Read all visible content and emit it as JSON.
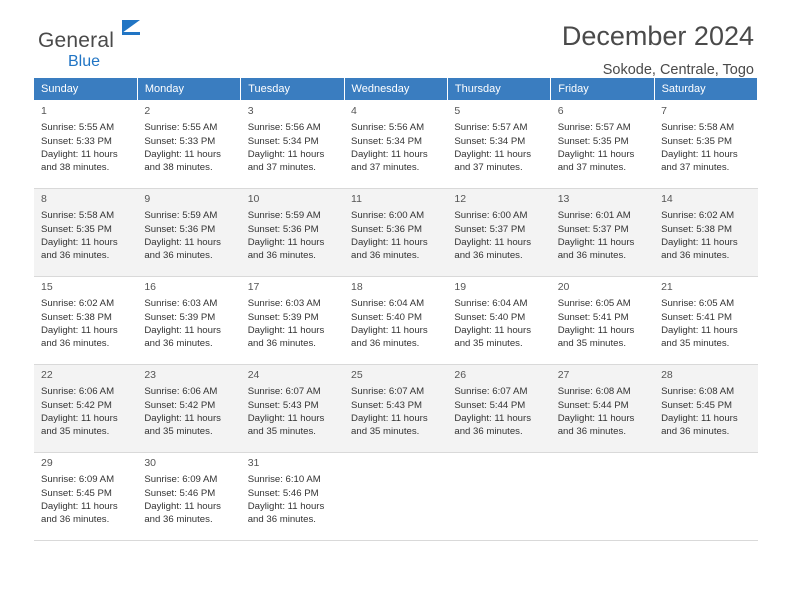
{
  "brand": {
    "line1": "General",
    "line2": "Blue",
    "accent": "#2175c4",
    "flag_icon": "flag-icon"
  },
  "header": {
    "title": "December 2024",
    "subtitle": "Sokode, Centrale, Togo"
  },
  "calendar": {
    "header_bg": "#3a7dc0",
    "weekdays": [
      "Sunday",
      "Monday",
      "Tuesday",
      "Wednesday",
      "Thursday",
      "Friday",
      "Saturday"
    ],
    "weeks": [
      [
        {
          "day": "1",
          "sunrise": "Sunrise: 5:55 AM",
          "sunset": "Sunset: 5:33 PM",
          "daylight1": "Daylight: 11 hours",
          "daylight2": "and 38 minutes."
        },
        {
          "day": "2",
          "sunrise": "Sunrise: 5:55 AM",
          "sunset": "Sunset: 5:33 PM",
          "daylight1": "Daylight: 11 hours",
          "daylight2": "and 38 minutes."
        },
        {
          "day": "3",
          "sunrise": "Sunrise: 5:56 AM",
          "sunset": "Sunset: 5:34 PM",
          "daylight1": "Daylight: 11 hours",
          "daylight2": "and 37 minutes."
        },
        {
          "day": "4",
          "sunrise": "Sunrise: 5:56 AM",
          "sunset": "Sunset: 5:34 PM",
          "daylight1": "Daylight: 11 hours",
          "daylight2": "and 37 minutes."
        },
        {
          "day": "5",
          "sunrise": "Sunrise: 5:57 AM",
          "sunset": "Sunset: 5:34 PM",
          "daylight1": "Daylight: 11 hours",
          "daylight2": "and 37 minutes."
        },
        {
          "day": "6",
          "sunrise": "Sunrise: 5:57 AM",
          "sunset": "Sunset: 5:35 PM",
          "daylight1": "Daylight: 11 hours",
          "daylight2": "and 37 minutes."
        },
        {
          "day": "7",
          "sunrise": "Sunrise: 5:58 AM",
          "sunset": "Sunset: 5:35 PM",
          "daylight1": "Daylight: 11 hours",
          "daylight2": "and 37 minutes."
        }
      ],
      [
        {
          "day": "8",
          "sunrise": "Sunrise: 5:58 AM",
          "sunset": "Sunset: 5:35 PM",
          "daylight1": "Daylight: 11 hours",
          "daylight2": "and 36 minutes."
        },
        {
          "day": "9",
          "sunrise": "Sunrise: 5:59 AM",
          "sunset": "Sunset: 5:36 PM",
          "daylight1": "Daylight: 11 hours",
          "daylight2": "and 36 minutes."
        },
        {
          "day": "10",
          "sunrise": "Sunrise: 5:59 AM",
          "sunset": "Sunset: 5:36 PM",
          "daylight1": "Daylight: 11 hours",
          "daylight2": "and 36 minutes."
        },
        {
          "day": "11",
          "sunrise": "Sunrise: 6:00 AM",
          "sunset": "Sunset: 5:36 PM",
          "daylight1": "Daylight: 11 hours",
          "daylight2": "and 36 minutes."
        },
        {
          "day": "12",
          "sunrise": "Sunrise: 6:00 AM",
          "sunset": "Sunset: 5:37 PM",
          "daylight1": "Daylight: 11 hours",
          "daylight2": "and 36 minutes."
        },
        {
          "day": "13",
          "sunrise": "Sunrise: 6:01 AM",
          "sunset": "Sunset: 5:37 PM",
          "daylight1": "Daylight: 11 hours",
          "daylight2": "and 36 minutes."
        },
        {
          "day": "14",
          "sunrise": "Sunrise: 6:02 AM",
          "sunset": "Sunset: 5:38 PM",
          "daylight1": "Daylight: 11 hours",
          "daylight2": "and 36 minutes."
        }
      ],
      [
        {
          "day": "15",
          "sunrise": "Sunrise: 6:02 AM",
          "sunset": "Sunset: 5:38 PM",
          "daylight1": "Daylight: 11 hours",
          "daylight2": "and 36 minutes."
        },
        {
          "day": "16",
          "sunrise": "Sunrise: 6:03 AM",
          "sunset": "Sunset: 5:39 PM",
          "daylight1": "Daylight: 11 hours",
          "daylight2": "and 36 minutes."
        },
        {
          "day": "17",
          "sunrise": "Sunrise: 6:03 AM",
          "sunset": "Sunset: 5:39 PM",
          "daylight1": "Daylight: 11 hours",
          "daylight2": "and 36 minutes."
        },
        {
          "day": "18",
          "sunrise": "Sunrise: 6:04 AM",
          "sunset": "Sunset: 5:40 PM",
          "daylight1": "Daylight: 11 hours",
          "daylight2": "and 36 minutes."
        },
        {
          "day": "19",
          "sunrise": "Sunrise: 6:04 AM",
          "sunset": "Sunset: 5:40 PM",
          "daylight1": "Daylight: 11 hours",
          "daylight2": "and 35 minutes."
        },
        {
          "day": "20",
          "sunrise": "Sunrise: 6:05 AM",
          "sunset": "Sunset: 5:41 PM",
          "daylight1": "Daylight: 11 hours",
          "daylight2": "and 35 minutes."
        },
        {
          "day": "21",
          "sunrise": "Sunrise: 6:05 AM",
          "sunset": "Sunset: 5:41 PM",
          "daylight1": "Daylight: 11 hours",
          "daylight2": "and 35 minutes."
        }
      ],
      [
        {
          "day": "22",
          "sunrise": "Sunrise: 6:06 AM",
          "sunset": "Sunset: 5:42 PM",
          "daylight1": "Daylight: 11 hours",
          "daylight2": "and 35 minutes."
        },
        {
          "day": "23",
          "sunrise": "Sunrise: 6:06 AM",
          "sunset": "Sunset: 5:42 PM",
          "daylight1": "Daylight: 11 hours",
          "daylight2": "and 35 minutes."
        },
        {
          "day": "24",
          "sunrise": "Sunrise: 6:07 AM",
          "sunset": "Sunset: 5:43 PM",
          "daylight1": "Daylight: 11 hours",
          "daylight2": "and 35 minutes."
        },
        {
          "day": "25",
          "sunrise": "Sunrise: 6:07 AM",
          "sunset": "Sunset: 5:43 PM",
          "daylight1": "Daylight: 11 hours",
          "daylight2": "and 35 minutes."
        },
        {
          "day": "26",
          "sunrise": "Sunrise: 6:07 AM",
          "sunset": "Sunset: 5:44 PM",
          "daylight1": "Daylight: 11 hours",
          "daylight2": "and 36 minutes."
        },
        {
          "day": "27",
          "sunrise": "Sunrise: 6:08 AM",
          "sunset": "Sunset: 5:44 PM",
          "daylight1": "Daylight: 11 hours",
          "daylight2": "and 36 minutes."
        },
        {
          "day": "28",
          "sunrise": "Sunrise: 6:08 AM",
          "sunset": "Sunset: 5:45 PM",
          "daylight1": "Daylight: 11 hours",
          "daylight2": "and 36 minutes."
        }
      ],
      [
        {
          "day": "29",
          "sunrise": "Sunrise: 6:09 AM",
          "sunset": "Sunset: 5:45 PM",
          "daylight1": "Daylight: 11 hours",
          "daylight2": "and 36 minutes."
        },
        {
          "day": "30",
          "sunrise": "Sunrise: 6:09 AM",
          "sunset": "Sunset: 5:46 PM",
          "daylight1": "Daylight: 11 hours",
          "daylight2": "and 36 minutes."
        },
        {
          "day": "31",
          "sunrise": "Sunrise: 6:10 AM",
          "sunset": "Sunset: 5:46 PM",
          "daylight1": "Daylight: 11 hours",
          "daylight2": "and 36 minutes."
        },
        null,
        null,
        null,
        null
      ]
    ]
  }
}
